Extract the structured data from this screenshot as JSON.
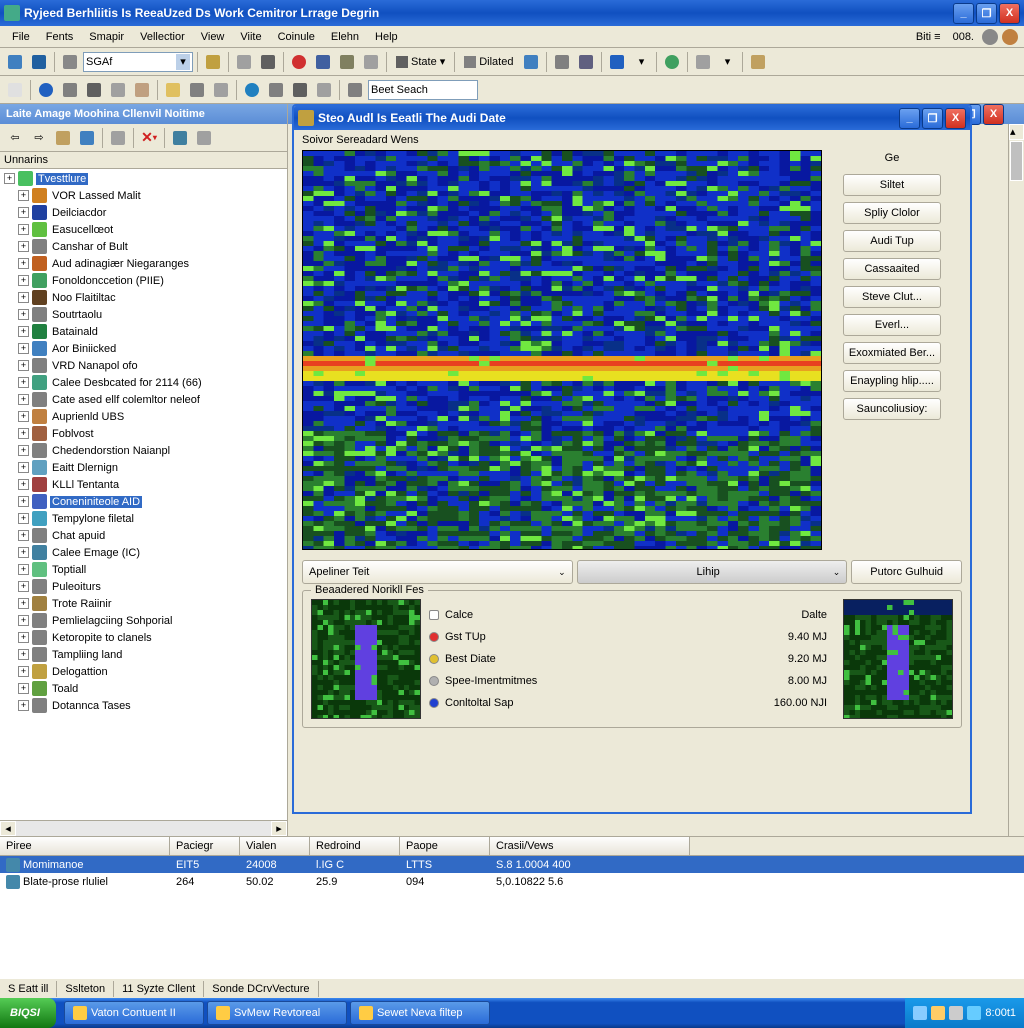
{
  "main_title": "Ryjeed Berhliitis Is ReeaUzed Ds Work Cemitror Lrrage Degrin",
  "menubar": [
    "File",
    "Fents",
    "Smapir",
    "Vellectior",
    "View",
    "Viite",
    "Coinule",
    "Elehn",
    "Help"
  ],
  "menubar_right": [
    "Biti ≡",
    "008."
  ],
  "toolbar1_combo": "SGAf",
  "toolbar1_state": "State",
  "toolbar1_dilated": "Dilated",
  "toolbar2_search": "Beet Seach",
  "left_panel_title": "Laite Amage Moohina Cllenvil Noitime",
  "tree_header": "Unnarins",
  "tree": [
    {
      "label": "Tvesttlure",
      "sel": true,
      "c": "#48c060"
    },
    {
      "label": "VOR Lassed Malit",
      "c": "#d08020"
    },
    {
      "label": "Deilciacdor",
      "c": "#2040a0"
    },
    {
      "label": "Easucellœot",
      "c": "#60c040"
    },
    {
      "label": "Canshar of Bult",
      "c": "#808080"
    },
    {
      "label": "Aud adinagiær Niegaranges",
      "c": "#c06020"
    },
    {
      "label": "Fonoldonccetion (PIIE)",
      "c": "#40a060"
    },
    {
      "label": "Noo Flaitiltac",
      "c": "#604020"
    },
    {
      "label": "Soutrtaolu",
      "c": "#808080"
    },
    {
      "label": "Batainald",
      "c": "#208040"
    },
    {
      "label": "Aor Biniicked",
      "c": "#4080c0"
    },
    {
      "label": "VRD Nanapol ofo",
      "c": "#808080"
    },
    {
      "label": "Calee Desbcated for 2114 (66)",
      "c": "#40a080"
    },
    {
      "label": "Cate ased ellf colemltor neleof",
      "c": "#808080"
    },
    {
      "label": "Auprienld UBS",
      "c": "#c08040"
    },
    {
      "label": "Foblvost",
      "c": "#a06040"
    },
    {
      "label": "Chedendorstion Naianpl",
      "c": "#808080"
    },
    {
      "label": "Eaitt Dlernign",
      "c": "#60a0c0"
    },
    {
      "label": "KLLl Tentanta",
      "c": "#a04040"
    },
    {
      "label": "Coneniniteole AID",
      "sel2": true,
      "c": "#4060c0"
    },
    {
      "label": "Tempylone filetal",
      "c": "#40a0c0"
    },
    {
      "label": "Chat apuid",
      "c": "#808080"
    },
    {
      "label": "Calee Emage (IC)",
      "c": "#4080a0"
    },
    {
      "label": "Toptiall",
      "c": "#60c080"
    },
    {
      "label": "Puleoiturs",
      "c": "#808080"
    },
    {
      "label": "Trote Raiinir",
      "c": "#a08040"
    },
    {
      "label": "Pemlielagciing Sohporial",
      "c": "#808080"
    },
    {
      "label": "Ketoropite to clanels",
      "c": "#808080"
    },
    {
      "label": "Tampliing land",
      "c": "#808080"
    },
    {
      "label": "Delogattion",
      "c": "#c0a040"
    },
    {
      "label": "Toald",
      "c": "#60a040"
    },
    {
      "label": "Dotannca Tases",
      "c": "#808080"
    }
  ],
  "inner_title": "Steo Audl Is Eeatli The Audi Date",
  "inner_subtitle": "Soivor Sereadard Wens",
  "right_header": "Ge",
  "right_buttons": [
    "Siltet",
    "Spliy Clolor",
    "Audi Tup",
    "Cassaaited",
    "Steve Clut...",
    "Everl...",
    "Exoxmiated Ber...",
    "Enaypling hlip.....",
    "Sauncoliusioy:"
  ],
  "mid_combo1": "Apeliner Teit",
  "mid_combo2": "Lihip",
  "mid_button": "Putorc Gulhuid",
  "group_title": "Beaadered Norikll Fes",
  "legend": [
    {
      "name": "Calce",
      "val": "Dalte",
      "color": "#ffffff"
    },
    {
      "name": "Gst TUp",
      "val": "9.40 MJ",
      "color": "#e03030"
    },
    {
      "name": "Best Diate",
      "val": "9.20 MJ",
      "color": "#e0c030"
    },
    {
      "name": "Spee-Imentmitmes",
      "val": "8.00 MJ",
      "color": "#b0b0b0"
    },
    {
      "name": "Conltoltal Sap",
      "val": "160.00 NJI",
      "color": "#2040d0"
    }
  ],
  "table_cols": [
    "Piree",
    "Paciegr",
    "Vialen",
    "Redroind",
    "Paope",
    "Crasii/Vews"
  ],
  "table_rows": [
    {
      "sel": true,
      "cells": [
        "Momimanoe",
        "EIT5",
        "24008",
        "l.IG C",
        "LTTS",
        "S.8 1.0004 400"
      ]
    },
    {
      "sel": false,
      "cells": [
        "Blate-prose rluliel",
        "264",
        "50.02",
        "25.9",
        "094",
        "5,0.10822 5.6"
      ]
    }
  ],
  "statusbar": [
    "S Eatt ill",
    "Sslteton",
    "11 Syzte Cllent",
    "Sonde DCrvVecture"
  ],
  "start": "BIQSI",
  "tasks": [
    "Vaton Contuent II",
    "SvMew Revtoreal",
    "Sewet Neva filtep"
  ],
  "clock": "8:00t1"
}
